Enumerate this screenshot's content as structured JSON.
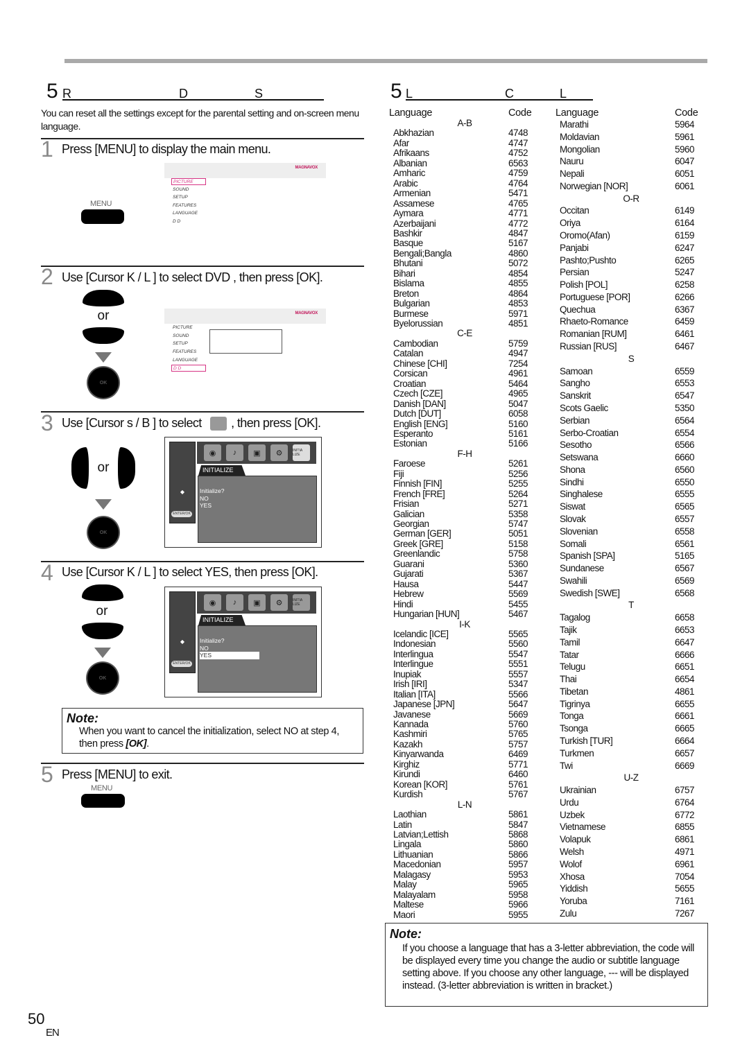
{
  "left_section": {
    "number": "5",
    "title_letters": [
      "R",
      "D",
      "S"
    ],
    "intro": "You can reset all the settings except for the parental setting and on-screen menu language.",
    "steps": [
      {
        "number": "1",
        "text": "Press [MENU] to display the main menu."
      },
      {
        "number": "2",
        "text": "Use [Cursor K / L ] to select  DVD , then press [OK]."
      },
      {
        "number": "3",
        "text_before": "Use [Cursor s  / B ] to select",
        "text_after": ", then press [OK]."
      },
      {
        "number": "4",
        "text": "Use [Cursor K / L ] to select  YES, then press [OK]."
      },
      {
        "number": "5",
        "text": "Press [MENU] to exit."
      }
    ],
    "menu_button_label": "MENU",
    "or_label": "or",
    "ok_label": "OK",
    "menu_screen": {
      "brand": "MAGNAVOX",
      "items": [
        "PICTURE",
        "SOUND",
        "SETUP",
        "FEATURES",
        "LANGUAGE",
        "D  D"
      ]
    },
    "init_screen": {
      "tab": "INITIALIZE",
      "question": "Initialize?",
      "options": [
        "NO",
        "YES"
      ],
      "enter_label": "ENTER/OK",
      "initialize_icon_label": "INITIA LIZE"
    },
    "note": {
      "title": "Note:",
      "text_before": "When you want to cancel the initialization, select  NO  at step 4, then press ",
      "text_bold": "[OK]",
      "text_after": "."
    }
  },
  "right_section": {
    "number": "5",
    "title_letters": [
      "L",
      "C",
      "L"
    ],
    "column_headers": {
      "language": "Language",
      "code": "Code"
    },
    "columns": [
      [
        {
          "range": "A-B",
          "entries": [
            [
              "Abkhazian",
              "4748"
            ],
            [
              "Afar",
              "4747"
            ],
            [
              "Afrikaans",
              "4752"
            ],
            [
              "Albanian",
              "6563"
            ],
            [
              "Amharic",
              "4759"
            ],
            [
              "Arabic",
              "4764"
            ],
            [
              "Armenian",
              "5471"
            ],
            [
              "Assamese",
              "4765"
            ],
            [
              "Aymara",
              "4771"
            ],
            [
              "Azerbaijani",
              "4772"
            ],
            [
              "Bashkir",
              "4847"
            ],
            [
              "Basque",
              "5167"
            ],
            [
              "Bengali;Bangla",
              "4860"
            ],
            [
              "Bhutani",
              "5072"
            ],
            [
              "Bihari",
              "4854"
            ],
            [
              "Bislama",
              "4855"
            ],
            [
              "Breton",
              "4864"
            ],
            [
              "Bulgarian",
              "4853"
            ],
            [
              "Burmese",
              "5971"
            ],
            [
              "Byelorussian",
              "4851"
            ]
          ]
        },
        {
          "range": "C-E",
          "entries": [
            [
              "Cambodian",
              "5759"
            ],
            [
              "Catalan",
              "4947"
            ],
            [
              "Chinese [CHI]",
              "7254"
            ],
            [
              "Corsican",
              "4961"
            ],
            [
              "Croatian",
              "5464"
            ],
            [
              "Czech [CZE]",
              "4965"
            ],
            [
              "Danish [DAN]",
              "5047"
            ],
            [
              "Dutch [DUT]",
              "6058"
            ],
            [
              "English [ENG]",
              "5160"
            ],
            [
              "Esperanto",
              "5161"
            ],
            [
              "Estonian",
              "5166"
            ]
          ]
        },
        {
          "range": "F-H",
          "entries": [
            [
              "Faroese",
              "5261"
            ],
            [
              "Fiji",
              "5256"
            ],
            [
              "Finnish [FIN]",
              "5255"
            ],
            [
              "French [FRE]",
              "5264"
            ],
            [
              "Frisian",
              "5271"
            ],
            [
              "Galician",
              "5358"
            ],
            [
              "Georgian",
              "5747"
            ],
            [
              "German [GER]",
              "5051"
            ],
            [
              "Greek [GRE]",
              "5158"
            ],
            [
              "Greenlandic",
              "5758"
            ],
            [
              "Guarani",
              "5360"
            ],
            [
              "Gujarati",
              "5367"
            ],
            [
              "Hausa",
              "5447"
            ],
            [
              "Hebrew",
              "5569"
            ],
            [
              "Hindi",
              "5455"
            ],
            [
              "Hungarian [HUN]",
              "5467"
            ]
          ]
        },
        {
          "range": "I-K",
          "entries": [
            [
              "Icelandic [ICE]",
              "5565"
            ],
            [
              "Indonesian",
              "5560"
            ],
            [
              "Interlingua",
              "5547"
            ],
            [
              "Interlingue",
              "5551"
            ],
            [
              "Inupiak",
              "5557"
            ],
            [
              "Irish [IRI]",
              "5347"
            ],
            [
              "Italian [ITA]",
              "5566"
            ],
            [
              "Japanese [JPN]",
              "5647"
            ],
            [
              "Javanese",
              "5669"
            ],
            [
              "Kannada",
              "5760"
            ],
            [
              "Kashmiri",
              "5765"
            ],
            [
              "Kazakh",
              "5757"
            ],
            [
              "Kinyarwanda",
              "6469"
            ],
            [
              "Kirghiz",
              "5771"
            ],
            [
              "Kirundi",
              "6460"
            ],
            [
              "Korean [KOR]",
              "5761"
            ],
            [
              "Kurdish",
              "5767"
            ]
          ]
        },
        {
          "range": "L-N",
          "entries": [
            [
              "Laothian",
              "5861"
            ],
            [
              "Latin",
              "5847"
            ],
            [
              "Latvian;Lettish",
              "5868"
            ],
            [
              "Lingala",
              "5860"
            ],
            [
              "Lithuanian",
              "5866"
            ],
            [
              "Macedonian",
              "5957"
            ],
            [
              "Malagasy",
              "5953"
            ],
            [
              "Malay",
              "5965"
            ],
            [
              "Malayalam",
              "5958"
            ],
            [
              "Maltese",
              "5966"
            ],
            [
              "Maori",
              "5955"
            ]
          ]
        }
      ],
      [
        {
          "range": "",
          "entries": [
            [
              "Marathi",
              "5964"
            ],
            [
              "Moldavian",
              "5961"
            ],
            [
              "Mongolian",
              "5960"
            ],
            [
              "Nauru",
              "6047"
            ],
            [
              "Nepali",
              "6051"
            ],
            [
              "Norwegian [NOR]",
              "6061"
            ]
          ]
        },
        {
          "range": "O-R",
          "entries": [
            [
              "Occitan",
              "6149"
            ],
            [
              "Oriya",
              "6164"
            ],
            [
              "Oromo(Afan)",
              "6159"
            ],
            [
              "Panjabi",
              "6247"
            ],
            [
              "Pashto;Pushto",
              "6265"
            ],
            [
              "Persian",
              "5247"
            ],
            [
              "Polish [POL]",
              "6258"
            ],
            [
              "Portuguese [POR]",
              "6266"
            ],
            [
              "Quechua",
              "6367"
            ],
            [
              "Rhaeto-Romance",
              "6459"
            ],
            [
              "Romanian [RUM]",
              "6461"
            ],
            [
              "Russian [RUS]",
              "6467"
            ]
          ]
        },
        {
          "range": "S",
          "entries": [
            [
              "Samoan",
              "6559"
            ],
            [
              "Sangho",
              "6553"
            ],
            [
              "Sanskrit",
              "6547"
            ],
            [
              "Scots Gaelic",
              "5350"
            ],
            [
              "Serbian",
              "6564"
            ],
            [
              "Serbo-Croatian",
              "6554"
            ],
            [
              "Sesotho",
              "6566"
            ],
            [
              "Setswana",
              "6660"
            ],
            [
              "Shona",
              "6560"
            ],
            [
              "Sindhi",
              "6550"
            ],
            [
              "Singhalese",
              "6555"
            ],
            [
              "Siswat",
              "6565"
            ],
            [
              "Slovak",
              "6557"
            ],
            [
              "Slovenian",
              "6558"
            ],
            [
              "Somali",
              "6561"
            ],
            [
              "Spanish [SPA]",
              "5165"
            ],
            [
              "Sundanese",
              "6567"
            ],
            [
              "Swahili",
              "6569"
            ],
            [
              "Swedish [SWE]",
              "6568"
            ]
          ]
        },
        {
          "range": "T",
          "entries": [
            [
              "Tagalog",
              "6658"
            ],
            [
              "Tajik",
              "6653"
            ],
            [
              "Tamil",
              "6647"
            ],
            [
              "Tatar",
              "6666"
            ],
            [
              "Telugu",
              "6651"
            ],
            [
              "Thai",
              "6654"
            ],
            [
              "Tibetan",
              "4861"
            ],
            [
              "Tigrinya",
              "6655"
            ],
            [
              "Tonga",
              "6661"
            ],
            [
              "Tsonga",
              "6665"
            ],
            [
              "Turkish [TUR]",
              "6664"
            ],
            [
              "Turkmen",
              "6657"
            ],
            [
              "Twi",
              "6669"
            ]
          ]
        },
        {
          "range": "U-Z",
          "entries": [
            [
              "Ukrainian",
              "6757"
            ],
            [
              "Urdu",
              "6764"
            ],
            [
              "Uzbek",
              "6772"
            ],
            [
              "Vietnamese",
              "6855"
            ],
            [
              "Volapuk",
              "6861"
            ],
            [
              "Welsh",
              "4971"
            ],
            [
              "Wolof",
              "6961"
            ],
            [
              "Xhosa",
              "7054"
            ],
            [
              "Yiddish",
              "5655"
            ],
            [
              "Yoruba",
              "7161"
            ],
            [
              "Zulu",
              "7267"
            ]
          ]
        }
      ]
    ],
    "note": {
      "title": "Note:",
      "text": "If you choose a language that has a 3-letter abbreviation, the code will be displayed every time you change the audio or subtitle language setting above. If you choose any other language, --- will be displayed instead. (3-letter abbreviation is written in bracket.)"
    }
  },
  "footer": {
    "page_number": "50",
    "language": "EN"
  },
  "colors": {
    "brand": "#c2185b",
    "highlight": "#d63384",
    "rule_gray": "#a9a9a9"
  }
}
